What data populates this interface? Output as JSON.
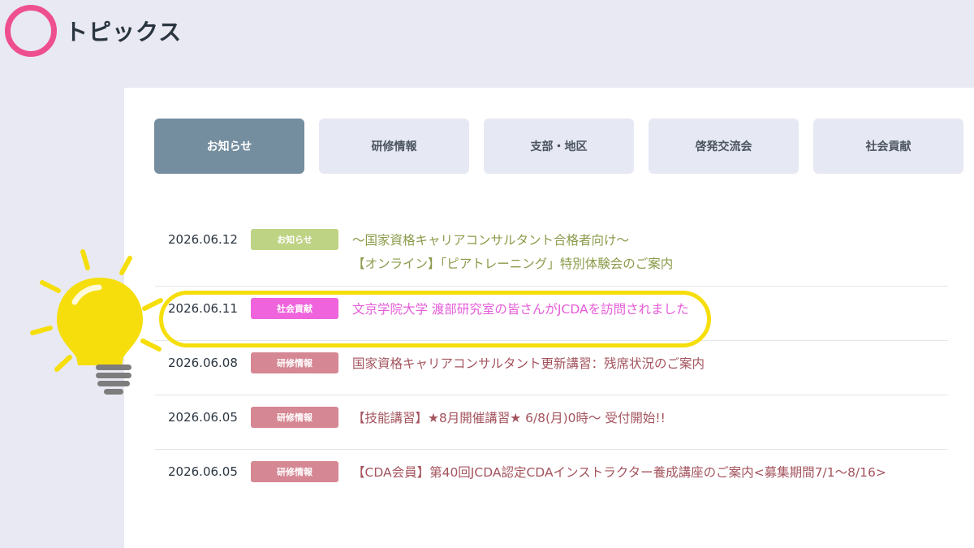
{
  "header": {
    "title": "トピックス"
  },
  "tabs": [
    {
      "label": "お知らせ",
      "active": true
    },
    {
      "label": "研修情報",
      "active": false
    },
    {
      "label": "支部・地区",
      "active": false
    },
    {
      "label": "啓発交流会",
      "active": false
    },
    {
      "label": "社会貢献",
      "active": false
    }
  ],
  "news": [
    {
      "date": "2026.06.12",
      "category": "お知らせ",
      "category_color": "#bfd384",
      "title_color": "#8a9b4a",
      "title_line1": "～国家資格キャリアコンサルタント合格者向け～",
      "title_line2": "【オンライン】「ピアトレーニング」特別体験会のご案内"
    },
    {
      "date": "2026.06.11",
      "category": "社会貢献",
      "category_color": "#ef63dc",
      "title_color": "#e55bd8",
      "title_line1": "文京学院大学 渡部研究室の皆さんがJCDAを訪問されました",
      "highlighted": true
    },
    {
      "date": "2026.06.08",
      "category": "研修情報",
      "category_color": "#d58793",
      "title_color": "#a4545e",
      "title_line1": "国家資格キャリアコンサルタント更新講習：残席状況のご案内"
    },
    {
      "date": "2026.06.05",
      "category": "研修情報",
      "category_color": "#d58793",
      "title_color": "#a4545e",
      "title_line1": "【技能講習】★8月開催講習★ 6/8(月)0時～ 受付開始!!"
    },
    {
      "date": "2026.06.05",
      "category": "研修情報",
      "category_color": "#d58793",
      "title_color": "#a4545e",
      "title_line1": "【CDA会員】第40回JCDA認定CDAインストラクター養成講座のご案内<募集期間7/1～8/16>"
    }
  ],
  "icons": {
    "ring": "ring-icon",
    "bulb": "lightbulb-icon"
  },
  "colors": {
    "accent": "#ee4f8e",
    "highlight": "#f6de0c",
    "tab_active": "#748d9f"
  }
}
